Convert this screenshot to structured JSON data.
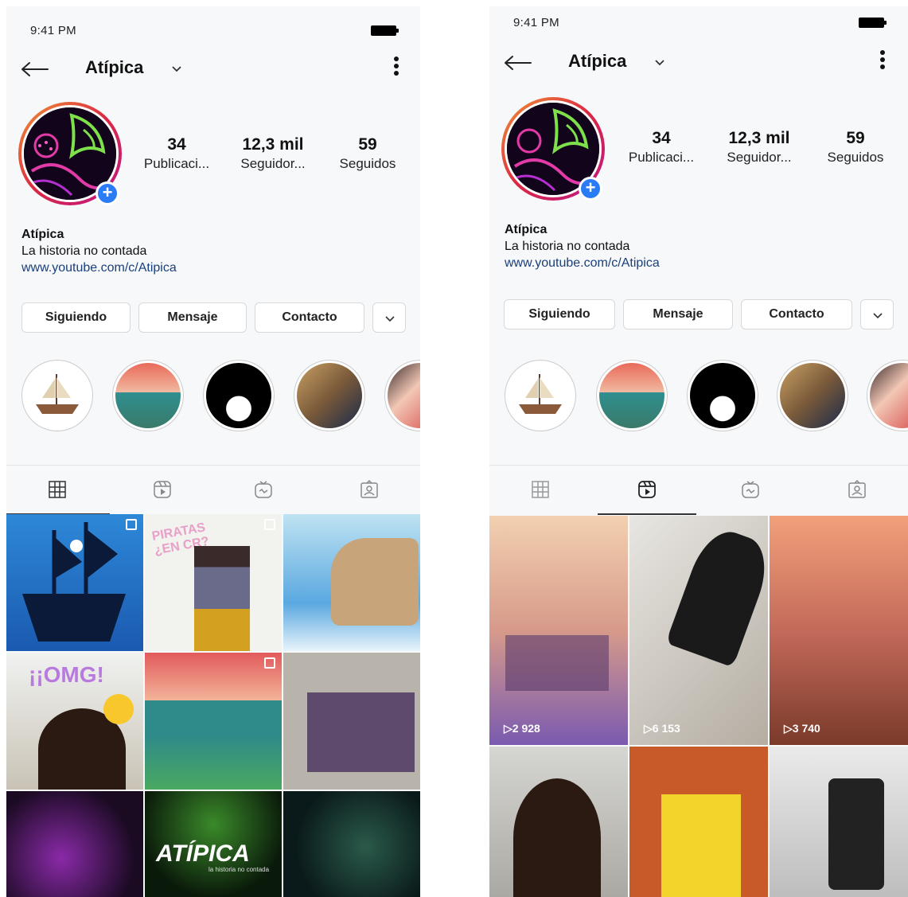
{
  "screens": [
    {
      "status": {
        "time": "9:41 PM"
      },
      "header": {
        "title": "Atípica"
      },
      "stats": [
        {
          "value": "34",
          "label": "Publicaci..."
        },
        {
          "value": "12,3 mil",
          "label": "Seguidor..."
        },
        {
          "value": "59",
          "label": "Seguidos"
        }
      ],
      "bio": {
        "name": "Atípica",
        "tagline": "La historia no contada",
        "link": "www.youtube.com/c/Atipica"
      },
      "buttons": {
        "following": "Siguiendo",
        "message": "Mensaje",
        "contact": "Contacto"
      },
      "active_tab": "grid",
      "grid_texts": {
        "piratas": "PIRATAS ¿EN CR?",
        "omg": "¡¡OMG!",
        "brand": "ATÍPICA",
        "brand_sub": "la historia no contada"
      }
    },
    {
      "status": {
        "time": "9:41 PM"
      },
      "header": {
        "title": "Atípica"
      },
      "stats": [
        {
          "value": "34",
          "label": "Publicaci..."
        },
        {
          "value": "12,3 mil",
          "label": "Seguidor..."
        },
        {
          "value": "59",
          "label": "Seguidos"
        }
      ],
      "bio": {
        "name": "Atípica",
        "tagline": "La historia no contada",
        "link": "www.youtube.com/c/Atipica"
      },
      "buttons": {
        "following": "Siguiendo",
        "message": "Mensaje",
        "contact": "Contacto"
      },
      "active_tab": "reels",
      "reels": [
        {
          "views": "2 928"
        },
        {
          "views": "6 153"
        },
        {
          "views": "3 740"
        }
      ]
    }
  ],
  "icons": [
    "back-arrow-icon",
    "chevron-down-icon",
    "more-vertical-icon",
    "add-story-icon",
    "grid-icon",
    "reels-icon",
    "igtv-icon",
    "tagged-icon",
    "play-icon",
    "multiple-posts-icon",
    "video-icon"
  ],
  "colors": {
    "link": "#1a3f7a",
    "plus": "#2a7bf6",
    "background": "#f7f8fa"
  }
}
